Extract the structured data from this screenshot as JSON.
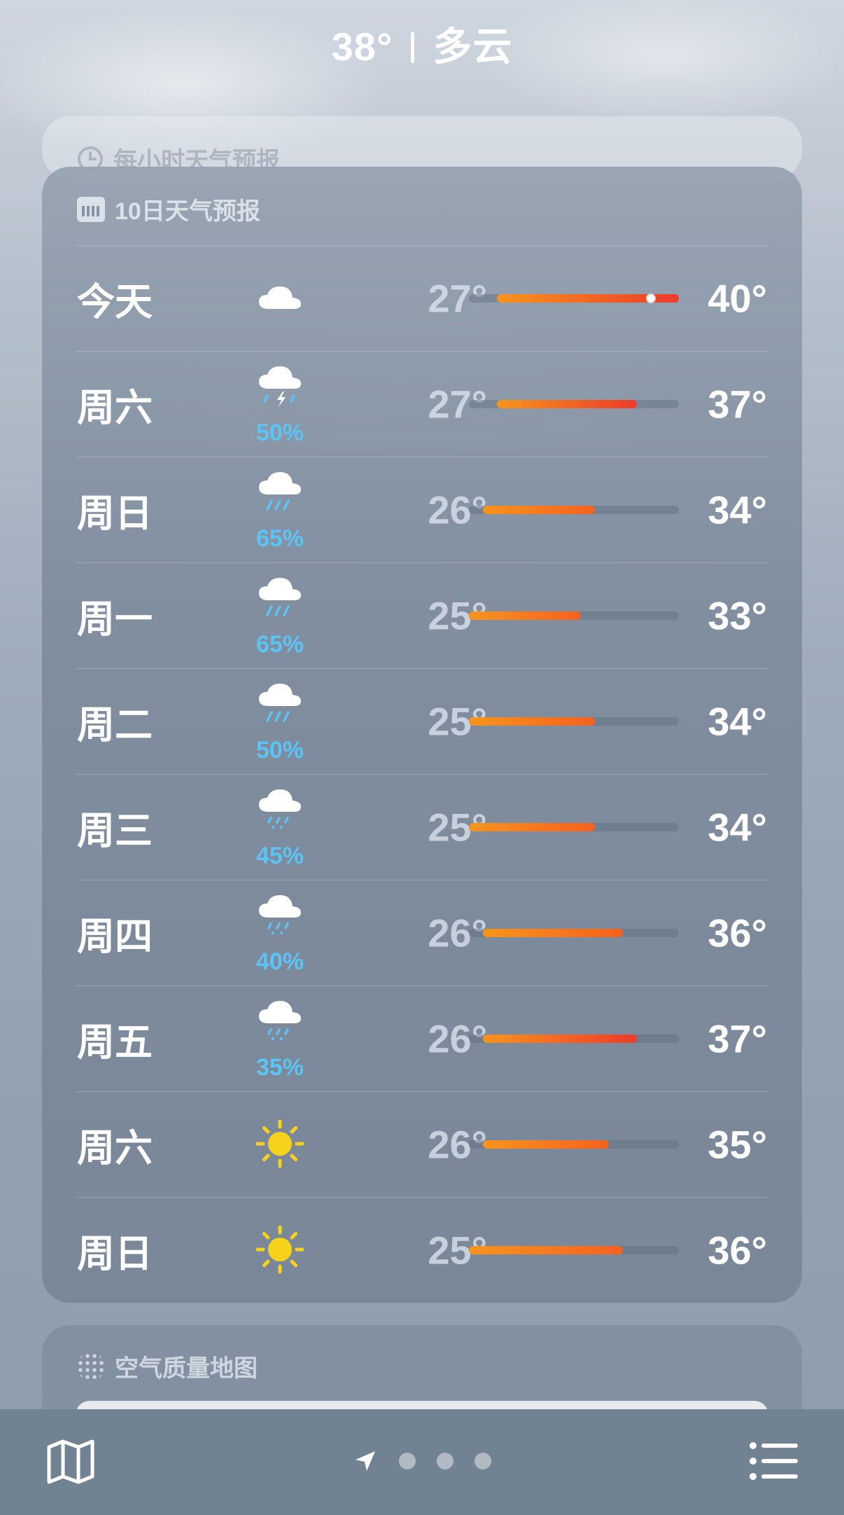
{
  "header": {
    "temp": "38°",
    "condition": "多云"
  },
  "hourly_card": {
    "title": "每小时天气预报"
  },
  "forecast_card": {
    "title": "10日天气预报",
    "range_min": 25,
    "range_max": 40,
    "current_temp": 38,
    "days": [
      {
        "day": "今天",
        "icon": "cloud-icon",
        "precip": "",
        "low": "27°",
        "high": "40°",
        "low_v": 27,
        "high_v": 40,
        "current": true
      },
      {
        "day": "周六",
        "icon": "thunderstorm-icon",
        "precip": "50%",
        "low": "27°",
        "high": "37°",
        "low_v": 27,
        "high_v": 37
      },
      {
        "day": "周日",
        "icon": "rain-heavy-icon",
        "precip": "65%",
        "low": "26°",
        "high": "34°",
        "low_v": 26,
        "high_v": 34
      },
      {
        "day": "周一",
        "icon": "rain-heavy-icon",
        "precip": "65%",
        "low": "25°",
        "high": "33°",
        "low_v": 25,
        "high_v": 33
      },
      {
        "day": "周二",
        "icon": "rain-heavy-icon",
        "precip": "50%",
        "low": "25°",
        "high": "34°",
        "low_v": 25,
        "high_v": 34
      },
      {
        "day": "周三",
        "icon": "rain-light-icon",
        "precip": "45%",
        "low": "25°",
        "high": "34°",
        "low_v": 25,
        "high_v": 34
      },
      {
        "day": "周四",
        "icon": "rain-light-icon",
        "precip": "40%",
        "low": "26°",
        "high": "36°",
        "low_v": 26,
        "high_v": 36
      },
      {
        "day": "周五",
        "icon": "rain-light-icon",
        "precip": "35%",
        "low": "26°",
        "high": "37°",
        "low_v": 26,
        "high_v": 37
      },
      {
        "day": "周六",
        "icon": "sun-icon",
        "precip": "",
        "low": "26°",
        "high": "35°",
        "low_v": 26,
        "high_v": 35
      },
      {
        "day": "周日",
        "icon": "sun-icon",
        "precip": "",
        "low": "25°",
        "high": "36°",
        "low_v": 25,
        "high_v": 36
      }
    ]
  },
  "air_card": {
    "title": "空气质量地图"
  },
  "bottom_bar": {
    "left_icon": "map-icon",
    "right_icon": "list-icon",
    "pages": 3,
    "location_icon": "location-arrow-icon"
  },
  "colors": {
    "precip": "#5bc4f5",
    "sun": "#f7d21c",
    "bar_warm": "#f7941d",
    "bar_hot": "#ee3b2b"
  }
}
